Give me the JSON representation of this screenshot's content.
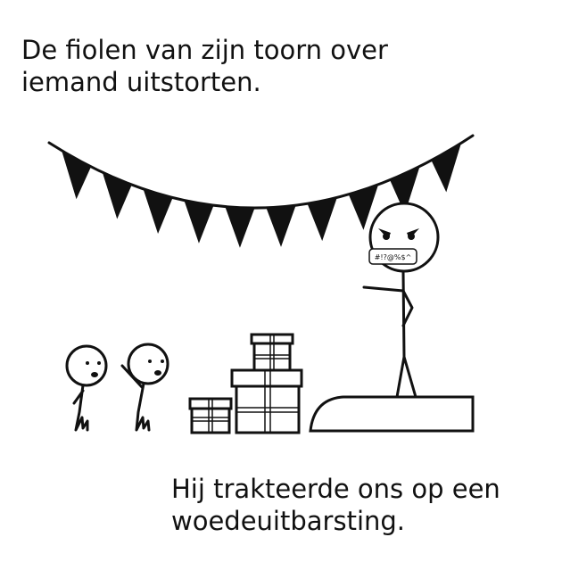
{
  "captions": {
    "top": [
      "De fiolen van zijn toorn over",
      "iemand uitstorten."
    ],
    "bottom": [
      "Hij trakteerde ons op een",
      "woedeuitbarsting."
    ]
  },
  "speech_bubble": "#!?@%$^",
  "colors": {
    "ink": "#111111",
    "background": "#ffffff"
  }
}
